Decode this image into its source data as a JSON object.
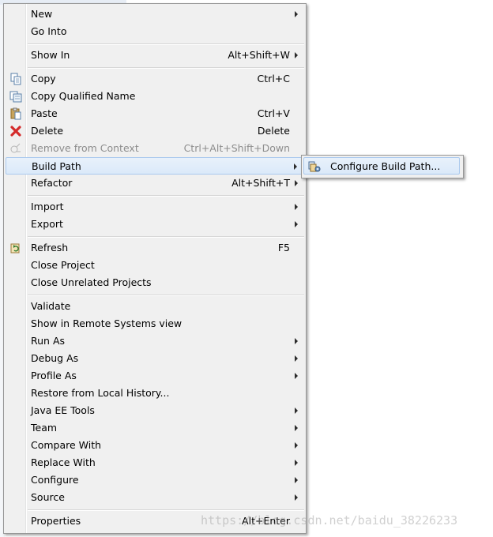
{
  "context_menu": {
    "items": [
      {
        "label": "New",
        "shortcut": "",
        "submenu": true,
        "icon": ""
      },
      {
        "label": "Go Into",
        "shortcut": "",
        "submenu": false,
        "icon": ""
      },
      {
        "label": "Show In",
        "shortcut": "Alt+Shift+W",
        "submenu": true,
        "icon": ""
      },
      {
        "label": "Copy",
        "shortcut": "Ctrl+C",
        "submenu": false,
        "icon": "copy-icon"
      },
      {
        "label": "Copy Qualified Name",
        "shortcut": "",
        "submenu": false,
        "icon": "copy-qualified-name-icon"
      },
      {
        "label": "Paste",
        "shortcut": "Ctrl+V",
        "submenu": false,
        "icon": "paste-icon"
      },
      {
        "label": "Delete",
        "shortcut": "Delete",
        "submenu": false,
        "icon": "delete-icon"
      },
      {
        "label": "Remove from Context",
        "shortcut": "Ctrl+Alt+Shift+Down",
        "submenu": false,
        "icon": "remove-from-context-icon",
        "disabled": true
      },
      {
        "label": "Build Path",
        "shortcut": "",
        "submenu": true,
        "icon": "",
        "highlighted": true
      },
      {
        "label": "Refactor",
        "shortcut": "Alt+Shift+T",
        "submenu": true,
        "icon": ""
      },
      {
        "label": "Import",
        "shortcut": "",
        "submenu": true,
        "icon": ""
      },
      {
        "label": "Export",
        "shortcut": "",
        "submenu": true,
        "icon": ""
      },
      {
        "label": "Refresh",
        "shortcut": "F5",
        "submenu": false,
        "icon": "refresh-icon"
      },
      {
        "label": "Close Project",
        "shortcut": "",
        "submenu": false,
        "icon": ""
      },
      {
        "label": "Close Unrelated Projects",
        "shortcut": "",
        "submenu": false,
        "icon": ""
      },
      {
        "label": "Validate",
        "shortcut": "",
        "submenu": false,
        "icon": ""
      },
      {
        "label": "Show in Remote Systems view",
        "shortcut": "",
        "submenu": false,
        "icon": ""
      },
      {
        "label": "Run As",
        "shortcut": "",
        "submenu": true,
        "icon": ""
      },
      {
        "label": "Debug As",
        "shortcut": "",
        "submenu": true,
        "icon": ""
      },
      {
        "label": "Profile As",
        "shortcut": "",
        "submenu": true,
        "icon": ""
      },
      {
        "label": "Restore from Local History...",
        "shortcut": "",
        "submenu": false,
        "icon": ""
      },
      {
        "label": "Java EE Tools",
        "shortcut": "",
        "submenu": true,
        "icon": ""
      },
      {
        "label": "Team",
        "shortcut": "",
        "submenu": true,
        "icon": ""
      },
      {
        "label": "Compare With",
        "shortcut": "",
        "submenu": true,
        "icon": ""
      },
      {
        "label": "Replace With",
        "shortcut": "",
        "submenu": true,
        "icon": ""
      },
      {
        "label": "Configure",
        "shortcut": "",
        "submenu": true,
        "icon": ""
      },
      {
        "label": "Source",
        "shortcut": "",
        "submenu": true,
        "icon": ""
      },
      {
        "label": "Properties",
        "shortcut": "Alt+Enter",
        "submenu": false,
        "icon": ""
      }
    ]
  },
  "build_path_submenu": {
    "items": [
      {
        "label": "Configure Build Path...",
        "icon": "configure-build-path-icon",
        "highlighted": true
      }
    ]
  },
  "watermark": "https://blog.csdn.net/baidu_38226233",
  "colors": {
    "menu_background": "#f0f0f0",
    "highlight": "#dbe9f9",
    "highlight_border": "#aac9ee",
    "disabled_text": "#8d8d8d",
    "delete_red": "#d42b2b"
  }
}
